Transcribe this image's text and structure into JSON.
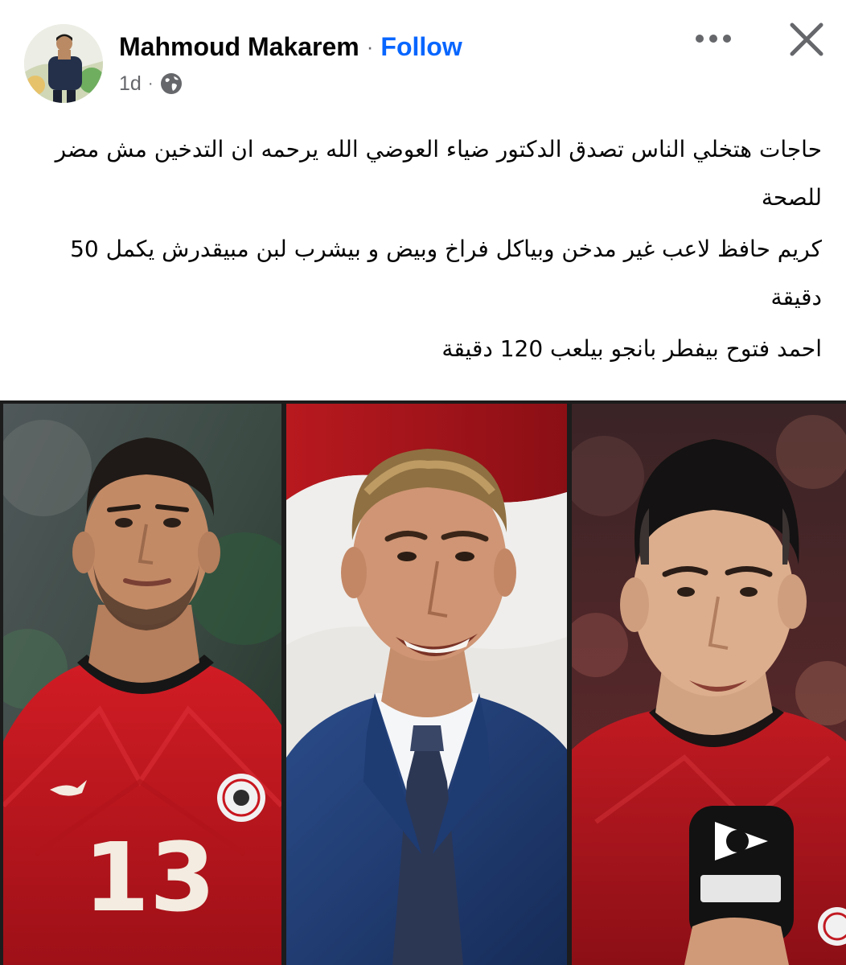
{
  "post": {
    "author": "Mahmoud Makarem",
    "separator": "·",
    "follow_label": "Follow",
    "timestamp": "1d",
    "meta_separator": "·",
    "privacy_icon": "globe-icon",
    "more_icon": "more-horizontal-icon",
    "close_icon": "close-icon",
    "paragraphs": [
      "حاجات هتخلي الناس تصدق الدكتور ضياء العوضي الله يرحمه ان التدخين مش مضر للصحة",
      "كريم حافظ لاعب غير مدخن وبياكل فراخ وبيض و بيشرب لبن مبيقدرش يكمل 50 دقيقة",
      "احمد فتوح بيفطر بانجو بيلعب 120 دقيقة"
    ]
  },
  "photos": {
    "jersey_number": "13",
    "colors": {
      "jersey_red": "#c8161e",
      "suit_navy": "#1f3a6e",
      "facebook_blue": "#0866ff",
      "muted_gray": "#65676b"
    }
  }
}
